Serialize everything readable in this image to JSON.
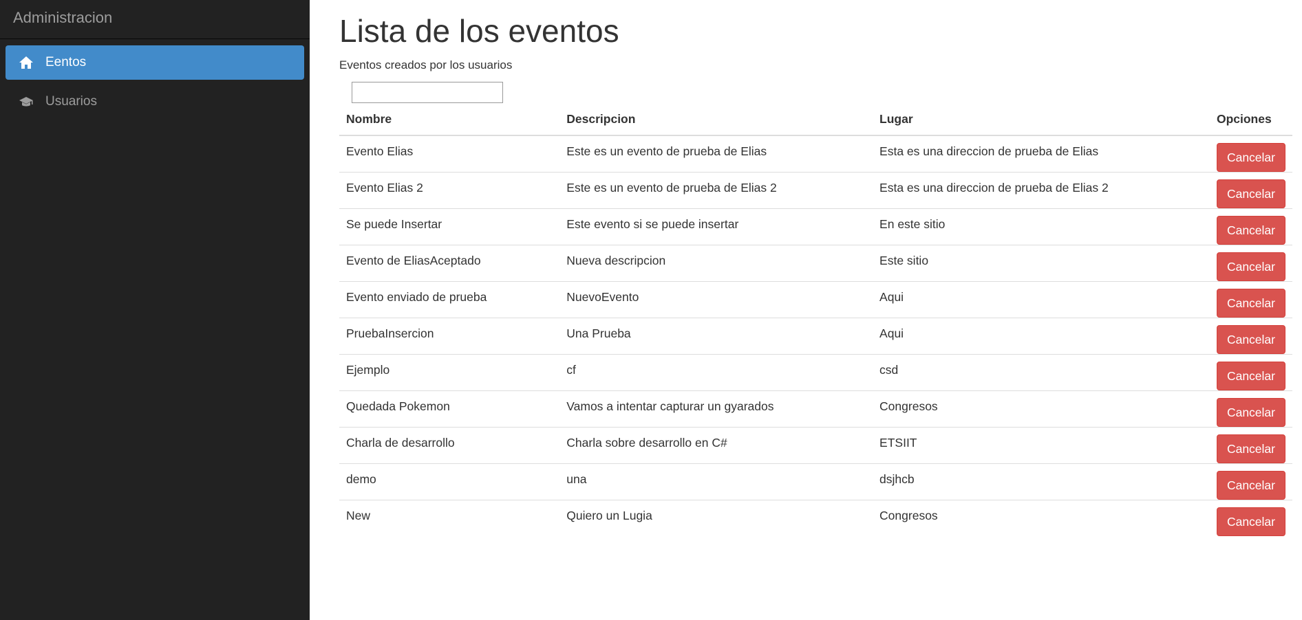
{
  "sidebar": {
    "brand": "Administracion",
    "items": [
      {
        "label": "Eentos",
        "icon": "home-icon",
        "active": true
      },
      {
        "label": "Usuarios",
        "icon": "graduation-cap-icon",
        "active": false
      }
    ]
  },
  "main": {
    "title": "Lista de los eventos",
    "subtitle": "Eventos creados por los usuarios",
    "search": {
      "value": "",
      "placeholder": ""
    },
    "table": {
      "headers": [
        "Nombre",
        "Descripcion",
        "Lugar",
        "Opciones"
      ],
      "cancel_label": "Cancelar",
      "rows": [
        {
          "nombre": "Evento Elias",
          "descripcion": "Este es un evento de prueba de Elias",
          "lugar": "Esta es una direccion de prueba de Elias"
        },
        {
          "nombre": "Evento Elias 2",
          "descripcion": "Este es un evento de prueba de Elias 2",
          "lugar": "Esta es una direccion de prueba de Elias 2"
        },
        {
          "nombre": "Se puede Insertar",
          "descripcion": "Este evento si se puede insertar",
          "lugar": "En este sitio"
        },
        {
          "nombre": "Evento de EliasAceptado",
          "descripcion": "Nueva descripcion",
          "lugar": "Este sitio"
        },
        {
          "nombre": "Evento enviado de prueba",
          "descripcion": "NuevoEvento",
          "lugar": "Aqui"
        },
        {
          "nombre": "PruebaInsercion",
          "descripcion": "Una Prueba",
          "lugar": "Aqui"
        },
        {
          "nombre": "Ejemplo",
          "descripcion": "cf",
          "lugar": "csd"
        },
        {
          "nombre": "Quedada Pokemon",
          "descripcion": "Vamos a intentar capturar un gyarados",
          "lugar": "Congresos"
        },
        {
          "nombre": "Charla de desarrollo",
          "descripcion": "Charla sobre desarrollo en C#",
          "lugar": "ETSIIT"
        },
        {
          "nombre": "demo",
          "descripcion": "una",
          "lugar": "dsjhcb"
        },
        {
          "nombre": "New",
          "descripcion": "Quiero un Lugia",
          "lugar": "Congresos"
        }
      ]
    }
  },
  "colors": {
    "sidebar_bg": "#222222",
    "active_item": "#428bca",
    "danger": "#d9534f"
  }
}
